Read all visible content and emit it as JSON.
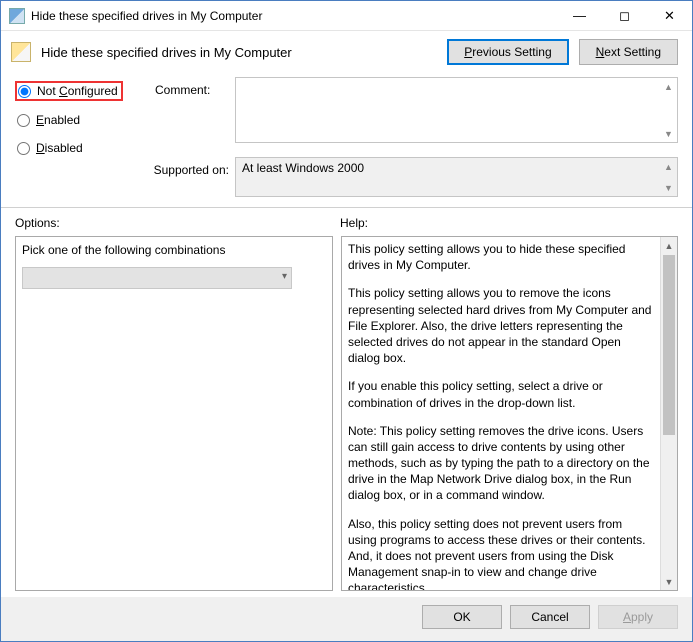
{
  "window": {
    "title": "Hide these specified drives in My Computer"
  },
  "header": {
    "title": "Hide these specified drives in My Computer"
  },
  "nav": {
    "prev_prefix": "P",
    "prev_rest": "revious Setting",
    "next_prefix": "N",
    "next_rest": "ext Setting"
  },
  "config": {
    "not_configured": {
      "prefix": "C",
      "pre": "Not ",
      "rest": "onfigured"
    },
    "enabled": {
      "prefix": "E",
      "rest": "nabled"
    },
    "disabled": {
      "prefix": "D",
      "rest": "isabled"
    },
    "comment_label": "Comment:",
    "supported_label": "Supported on:",
    "supported_text": "At least Windows 2000"
  },
  "labels": {
    "options": "Options:",
    "help": "Help:"
  },
  "options": {
    "combo_label": "Pick one of the following combinations"
  },
  "help": {
    "p1": "This policy setting allows you to hide these specified drives in My Computer.",
    "p2": "This policy setting allows you to remove the icons representing selected hard drives from My Computer and File Explorer. Also, the drive letters representing the selected drives do not appear in the standard Open dialog box.",
    "p3": "If you enable this policy setting, select a drive or combination of drives in the drop-down list.",
    "p4": "Note: This policy setting removes the drive icons. Users can still gain access to drive contents by using other methods, such as by typing the path to a directory on the drive in the Map Network Drive dialog box, in the Run dialog box, or in a command window.",
    "p5": "Also, this policy setting does not prevent users from using programs to access these drives or their contents. And, it does not prevent users from using the Disk Management snap-in to view and change drive characteristics."
  },
  "footer": {
    "ok": "OK",
    "cancel": "Cancel",
    "apply_prefix": "A",
    "apply_rest": "pply"
  }
}
